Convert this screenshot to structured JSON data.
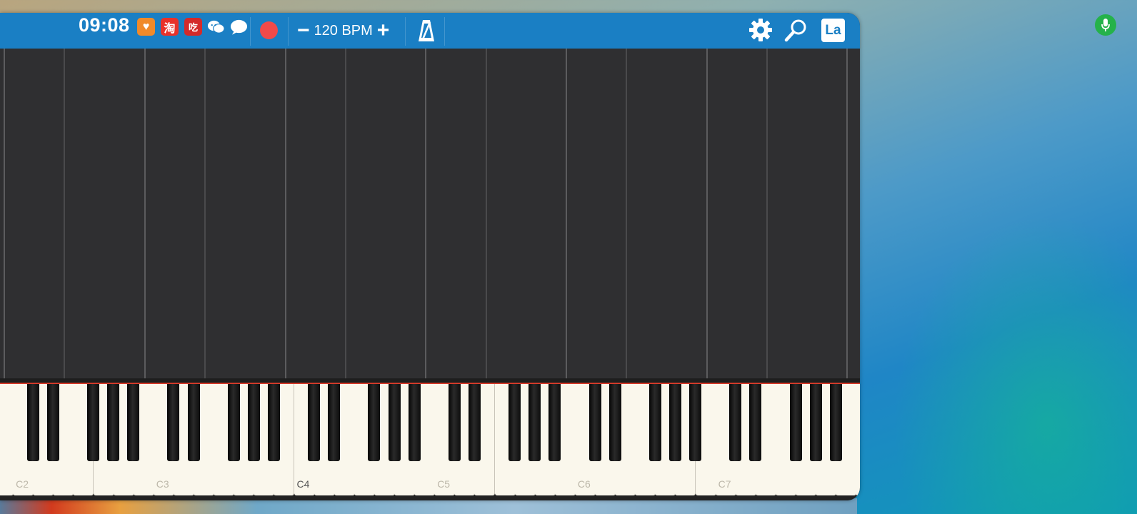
{
  "status_bar": {
    "time": "09:08",
    "icons": [
      {
        "name": "heart-app-icon",
        "glyph": "♥",
        "color": "#f08a2a"
      },
      {
        "name": "taobao-icon",
        "glyph": "淘",
        "color": "#e8322a"
      },
      {
        "name": "food-app-icon",
        "glyph": "吃",
        "color": "#d42a2a"
      },
      {
        "name": "wechat-icon",
        "glyph": "",
        "color": "#ffffff"
      },
      {
        "name": "message-bubble-icon",
        "glyph": "",
        "color": "#ffffff"
      }
    ]
  },
  "toolbar": {
    "bpm_minus": "−",
    "bpm_label": "120 BPM",
    "bpm_plus": "+",
    "lang_label": "La"
  },
  "keyboard": {
    "octave_labels": [
      "C2",
      "C3",
      "C4",
      "C5",
      "C6",
      "C7"
    ],
    "active_label": "C4"
  },
  "colors": {
    "toolbar": "#1a7fc4",
    "record": "#f24a4a",
    "piano_roll": "#2f2f31",
    "white_key": "#faf7ec",
    "black_key": "#111111",
    "mic_indicator": "#25b24a"
  }
}
